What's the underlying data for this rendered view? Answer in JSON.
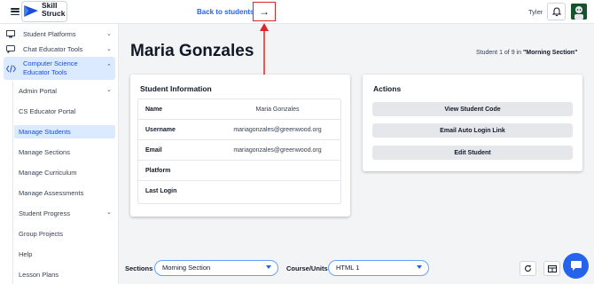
{
  "brand": {
    "line1": "Skill",
    "line2": "Struck"
  },
  "header": {
    "back_link": "Back to students",
    "next_icon": "arrow-right-icon",
    "user_name": "Tyler"
  },
  "sidebar": {
    "items": [
      {
        "label": "Student Platforms",
        "icon": "student-platforms-icon"
      },
      {
        "label": "Chat Educator Tools",
        "icon": "chat-icon"
      },
      {
        "label": "Computer Science Educator Tools",
        "label_line1": "Computer Science",
        "label_line2": "Educator Tools",
        "icon": "code-icon"
      }
    ],
    "sub_items": [
      {
        "label": "Admin Portal",
        "has_chevron": true
      },
      {
        "label": "CS Educator Portal"
      },
      {
        "label": "Manage Students",
        "active": true
      },
      {
        "label": "Manage Sections"
      },
      {
        "label": "Manage Curriculum"
      },
      {
        "label": "Manage Assessments"
      },
      {
        "label": "Student Progress",
        "has_chevron": true
      },
      {
        "label": "Group Projects"
      },
      {
        "label": "Help"
      },
      {
        "label": "Lesson Plans"
      }
    ]
  },
  "page": {
    "title": "Maria Gonzales",
    "counter_prefix": "Student 1 of 9  in ",
    "counter_section": "\"Morning Section\""
  },
  "student_info": {
    "title": "Student Information",
    "rows": [
      {
        "key": "Name",
        "value": "Maria Gonzales"
      },
      {
        "key": "Username",
        "value": "mariagonzales@greenwood.org"
      },
      {
        "key": "Email",
        "value": "mariagonzales@greenwood.org"
      },
      {
        "key": "Platform",
        "value": ""
      },
      {
        "key": "Last Login",
        "value": ""
      }
    ]
  },
  "actions": {
    "title": "Actions",
    "buttons": [
      "View Student Code",
      "Email Auto Login Link",
      "Edit Student"
    ]
  },
  "filters": {
    "sections_label": "Sections",
    "sections_value": "Morning Section",
    "course_label": "Course/Units",
    "course_value": "HTML 1"
  },
  "colors": {
    "accent": "#2563eb",
    "active_bg": "#dbeafe",
    "highlight": "#dc2626"
  }
}
